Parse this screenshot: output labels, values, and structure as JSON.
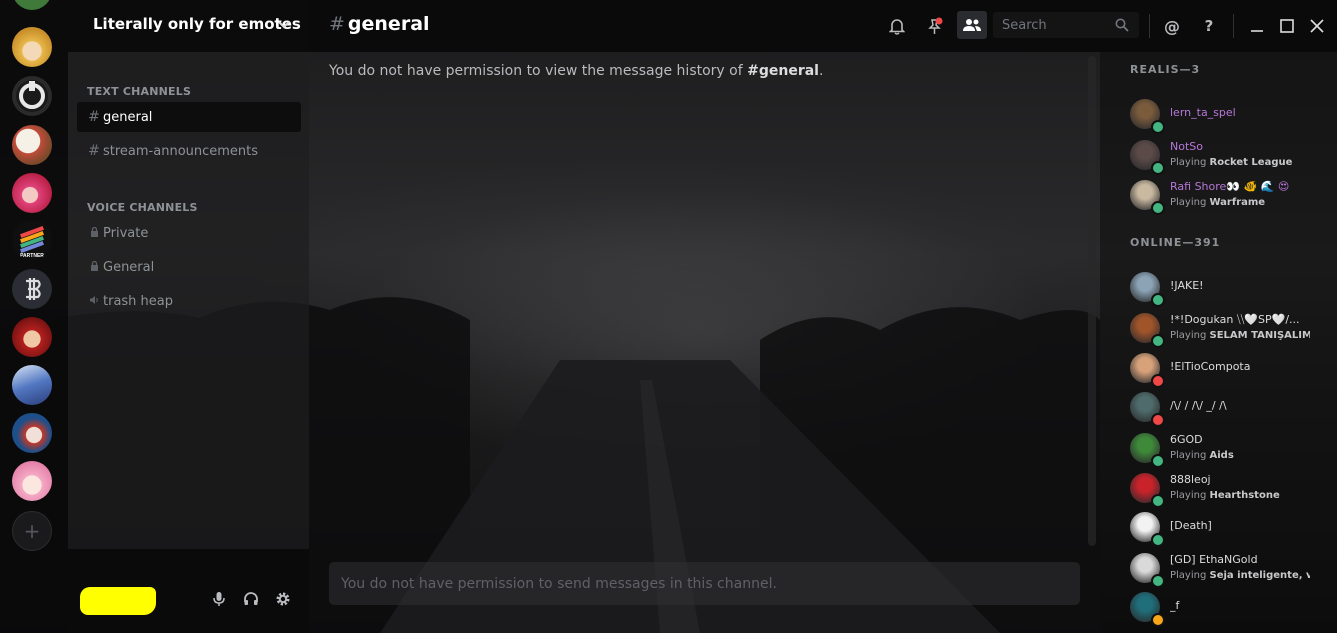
{
  "guild": {
    "name": "Literally only for emotes"
  },
  "categories": {
    "text": "TEXT CHANNELS",
    "voice": "VOICE CHANNELS"
  },
  "text_channels": [
    {
      "name": "general",
      "active": true
    },
    {
      "name": "stream-announcements",
      "active": false
    }
  ],
  "voice_channels": [
    {
      "name": "Private",
      "icon": "lock-icon"
    },
    {
      "name": "General",
      "icon": "lock-icon"
    },
    {
      "name": "trash heap",
      "icon": "speaker-icon"
    }
  ],
  "servers": [
    {
      "icon": "server-avatar-blonde-girl"
    },
    {
      "icon": "server-avatar-gear-logo"
    },
    {
      "icon": "server-avatar-cartoon-group"
    },
    {
      "icon": "server-avatar-pink-hair"
    },
    {
      "icon": "server-avatar-partner",
      "badge": "PARTNER"
    },
    {
      "icon": "server-avatar-crypto-logo"
    },
    {
      "icon": "server-avatar-red-hair"
    },
    {
      "icon": "server-avatar-blue-city"
    },
    {
      "icon": "server-avatar-anime-blue"
    },
    {
      "icon": "server-avatar-pink-anime"
    }
  ],
  "add_server": {
    "label": "+"
  },
  "header": {
    "hash": "#",
    "channel": "general",
    "search_placeholder": "Search"
  },
  "chat": {
    "history_prefix": "You do not have permission to view the message history of",
    "history_channel": "#general",
    "history_suffix": ".",
    "composer_placeholder": "You do not have permission to send messages in this channel."
  },
  "member_groups": {
    "role": "REALIS—3",
    "online": "ONLINE—391"
  },
  "members_role": [
    {
      "name": "lern_ta_spel",
      "playing": "",
      "status": "online",
      "color": "#7a5b3c"
    },
    {
      "name": "NotSo",
      "playing": "Rocket League",
      "status": "online",
      "color": "#5b4a48"
    },
    {
      "name": "Rafi Shore👀 🐠 🌊 😍",
      "playing": "Warframe",
      "status": "online",
      "color": "#c9b9a0"
    }
  ],
  "members_online": [
    {
      "name": "!JAKE!",
      "playing": "",
      "status": "online",
      "color": "#8ba3b5"
    },
    {
      "name": "!*!Dogukan ⧹⧹🤍SP🤍/...",
      "playing": "SELAM TANIŞALIMI ...",
      "status": "online",
      "color": "#a0542a"
    },
    {
      "name": "!ElTioCompota",
      "playing": "",
      "status": "dnd",
      "color": "#d7a27a"
    },
    {
      "name": "/\\/ / /\\/ _/ /\\",
      "playing": "",
      "status": "dnd",
      "color": "#4f6b6b"
    },
    {
      "name": "6GOD",
      "playing": "Aids",
      "status": "online",
      "color": "#3f8a3a"
    },
    {
      "name": "888leoj",
      "playing": "Hearthstone",
      "status": "online",
      "color": "#c8232b"
    },
    {
      "name": "[Death]",
      "playing": "",
      "status": "online",
      "color": "#f2f2f2"
    },
    {
      "name": "[GD] EthaNGold",
      "playing": "Seja inteligente, vi...",
      "status": "online",
      "color": "#d9d9d9"
    },
    {
      "name": "_f",
      "playing": "",
      "status": "idle",
      "color": "#1f6e7a"
    }
  ],
  "playing_prefix": "Playing",
  "status_colors": {
    "online": "#43b581",
    "dnd": "#f04747",
    "idle": "#faa61a"
  },
  "user_panel": {
    "name_redacted_color": "#ffff00"
  }
}
